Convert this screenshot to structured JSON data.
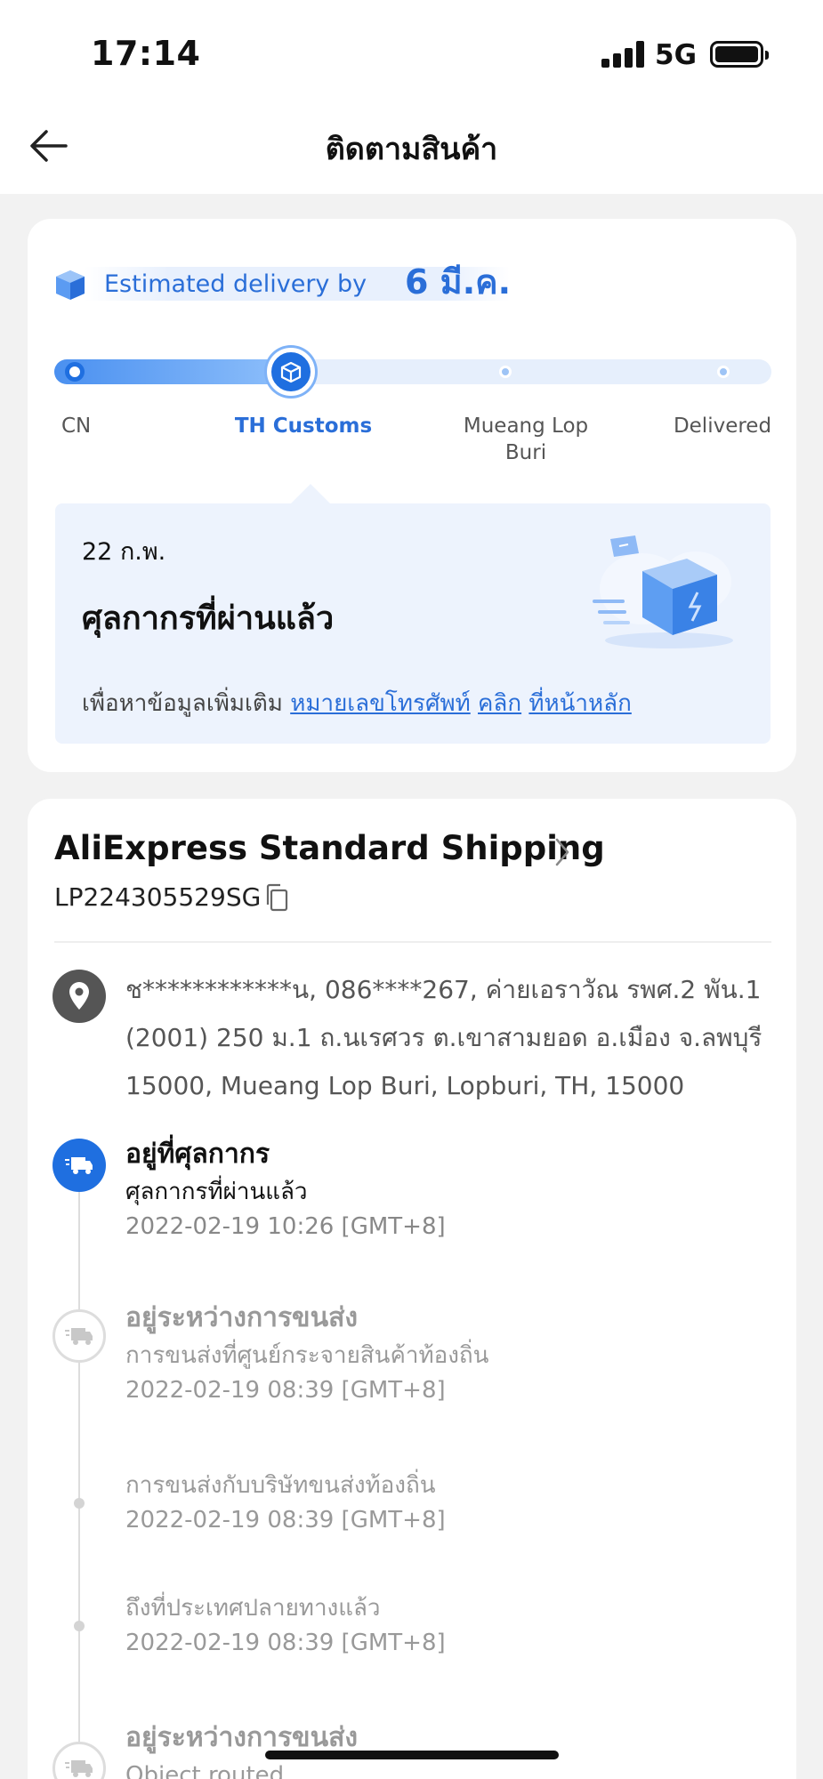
{
  "status_bar": {
    "time": "17:14",
    "network": "5G",
    "battery_level": 1.0
  },
  "nav": {
    "title": "ติดตามสินค้า",
    "back_icon": "arrow-left-icon"
  },
  "delivery": {
    "estimated_label": "Estimated delivery by",
    "estimated_date": "6 มี.ค.",
    "progress_fraction": 0.33,
    "stages": [
      {
        "label": "CN",
        "state": "done"
      },
      {
        "label": "TH Customs",
        "state": "current"
      },
      {
        "label": "Mueang Lop Buri",
        "state": "pending"
      },
      {
        "label": "Delivered",
        "state": "pending"
      }
    ]
  },
  "latest_status": {
    "date": "22 ก.พ.",
    "status": "ศุลกากรที่ผ่านแล้ว",
    "info_prefix": "เพื่อหาข้อมูลเพิ่มเติม",
    "link_phone": "หมายเลขโทรศัพท์",
    "link_click": "คลิก",
    "link_home": "ที่หน้าหลัก"
  },
  "shipping": {
    "carrier": "AliExpress Standard Shipping",
    "tracking_number": "LP224305529SG",
    "address": "ช************น, 086****267, ค่ายเอราวัณ รพศ.2 พัน.1 (2001) 250 ม.1 ถ.นเรศวร ต.เขาสามยอด อ.เมือง จ.ลพบุรี 15000, Mueang Lop Buri, Lopburi, TH, 15000"
  },
  "timeline": [
    {
      "title": "อยู่ที่ศุลกากร",
      "desc": "ศุลกากรที่ผ่านแล้ว",
      "time": "2022-02-19 10:26 [GMT+8]",
      "active": true
    },
    {
      "title": "อยู่ระหว่างการขนส่ง",
      "desc": "การขนส่งที่ศูนย์กระจายสินค้าท้องถิ่น",
      "time": "2022-02-19 08:39 [GMT+8]",
      "active": false
    },
    {
      "title": "",
      "desc": "การขนส่งกับบริษัทขนส่งท้องถิ่น",
      "time": "2022-02-19 08:39 [GMT+8]",
      "active": false
    },
    {
      "title": "",
      "desc": "ถึงที่ประเทศปลายทางแล้ว",
      "time": "2022-02-19 08:39 [GMT+8]",
      "active": false
    },
    {
      "title": "อยู่ระหว่างการขนส่ง",
      "desc": "Object routed",
      "time": "",
      "active": false
    }
  ],
  "colors": {
    "accent": "#1f6fe0",
    "accent_text": "#2a6ed8",
    "panel_bg": "#edf3fd",
    "page_bg": "#f2f2f2"
  }
}
